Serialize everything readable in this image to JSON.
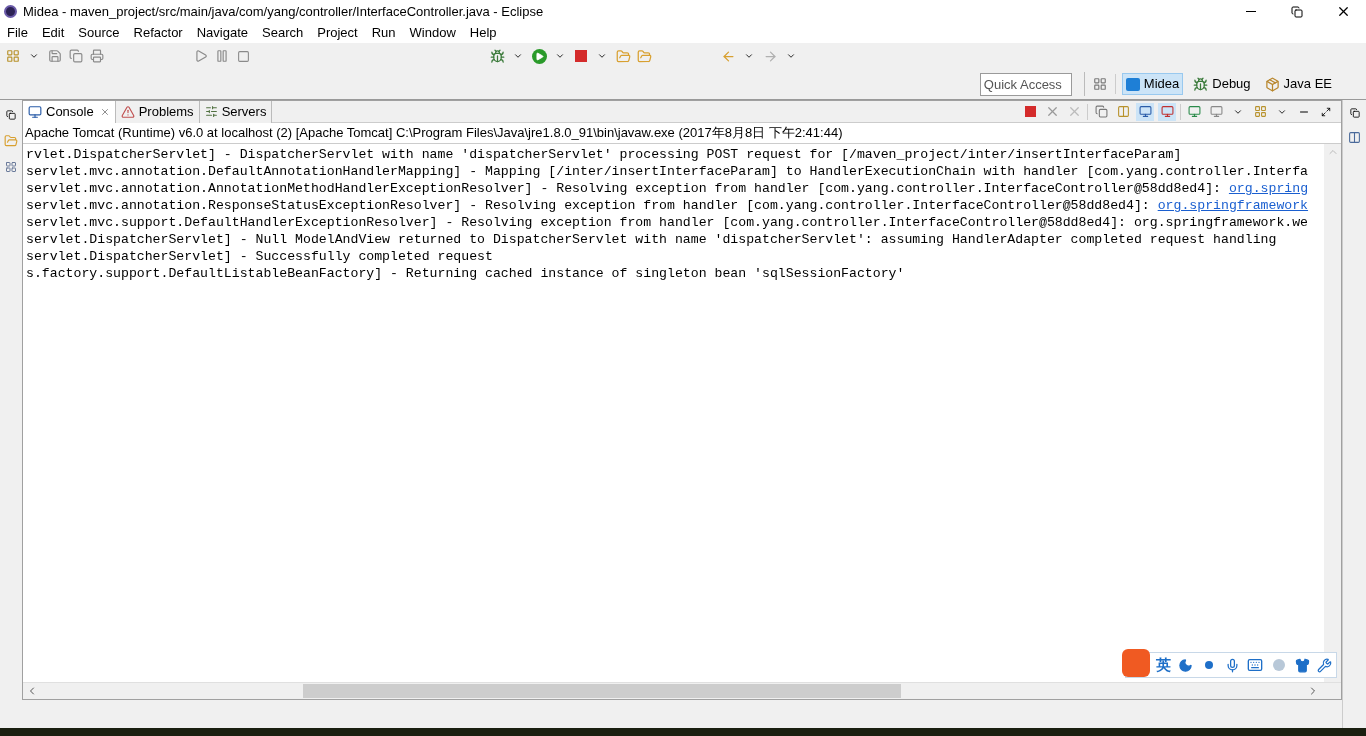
{
  "window": {
    "title": "Midea - maven_project/src/main/java/com/yang/controller/InterfaceController.java - Eclipse"
  },
  "menu": [
    "File",
    "Edit",
    "Source",
    "Refactor",
    "Navigate",
    "Search",
    "Project",
    "Run",
    "Window",
    "Help"
  ],
  "quick_access": {
    "placeholder": "Quick Access"
  },
  "perspectives": [
    {
      "label": "Midea",
      "selected": true,
      "kind": "midea"
    },
    {
      "label": "Debug",
      "selected": false,
      "kind": "debug"
    },
    {
      "label": "Java EE",
      "selected": false,
      "kind": "javaee"
    }
  ],
  "view_tabs": [
    {
      "label": "Console",
      "selected": true,
      "kind": "console"
    },
    {
      "label": "Problems",
      "selected": false,
      "kind": "problems"
    },
    {
      "label": "Servers",
      "selected": false,
      "kind": "servers"
    }
  ],
  "console": {
    "header": "Apache Tomcat (Runtime) v6.0 at localhost (2) [Apache Tomcat] C:\\Program Files\\Java\\jre1.8.0_91\\bin\\javaw.exe (2017年8月8日 下午2:41:44)",
    "lines": [
      {
        "text": "rvlet.DispatcherServlet] - DispatcherServlet with name 'dispatcherServlet' processing POST request for [/maven_project/inter/insertInterfaceParam]"
      },
      {
        "text": "servlet.mvc.annotation.DefaultAnnotationHandlerMapping] - Mapping [/inter/insertInterfaceParam] to HandlerExecutionChain with handler [com.yang.controller.Interfa"
      },
      {
        "text": "servlet.mvc.annotation.AnnotationMethodHandlerExceptionResolver] - Resolving exception from handler [com.yang.controller.InterfaceController@58dd8ed4]: ",
        "link": "org.spring"
      },
      {
        "text": "servlet.mvc.annotation.ResponseStatusExceptionResolver] - Resolving exception from handler [com.yang.controller.InterfaceController@58dd8ed4]: ",
        "link": "org.springframework"
      },
      {
        "text": "servlet.mvc.support.DefaultHandlerExceptionResolver] - Resolving exception from handler [com.yang.controller.InterfaceController@58dd8ed4]: org.springframework.we"
      },
      {
        "text": "servlet.DispatcherServlet] - Null ModelAndView returned to DispatcherServlet with name 'dispatcherServlet': assuming HandlerAdapter completed request handling"
      },
      {
        "text": "servlet.DispatcherServlet] - Successfully completed request"
      },
      {
        "text": "s.factory.support.DefaultListableBeanFactory] - Returning cached instance of singleton bean 'sqlSessionFactory'"
      }
    ]
  },
  "ime_toolbar": {
    "language": "英"
  }
}
